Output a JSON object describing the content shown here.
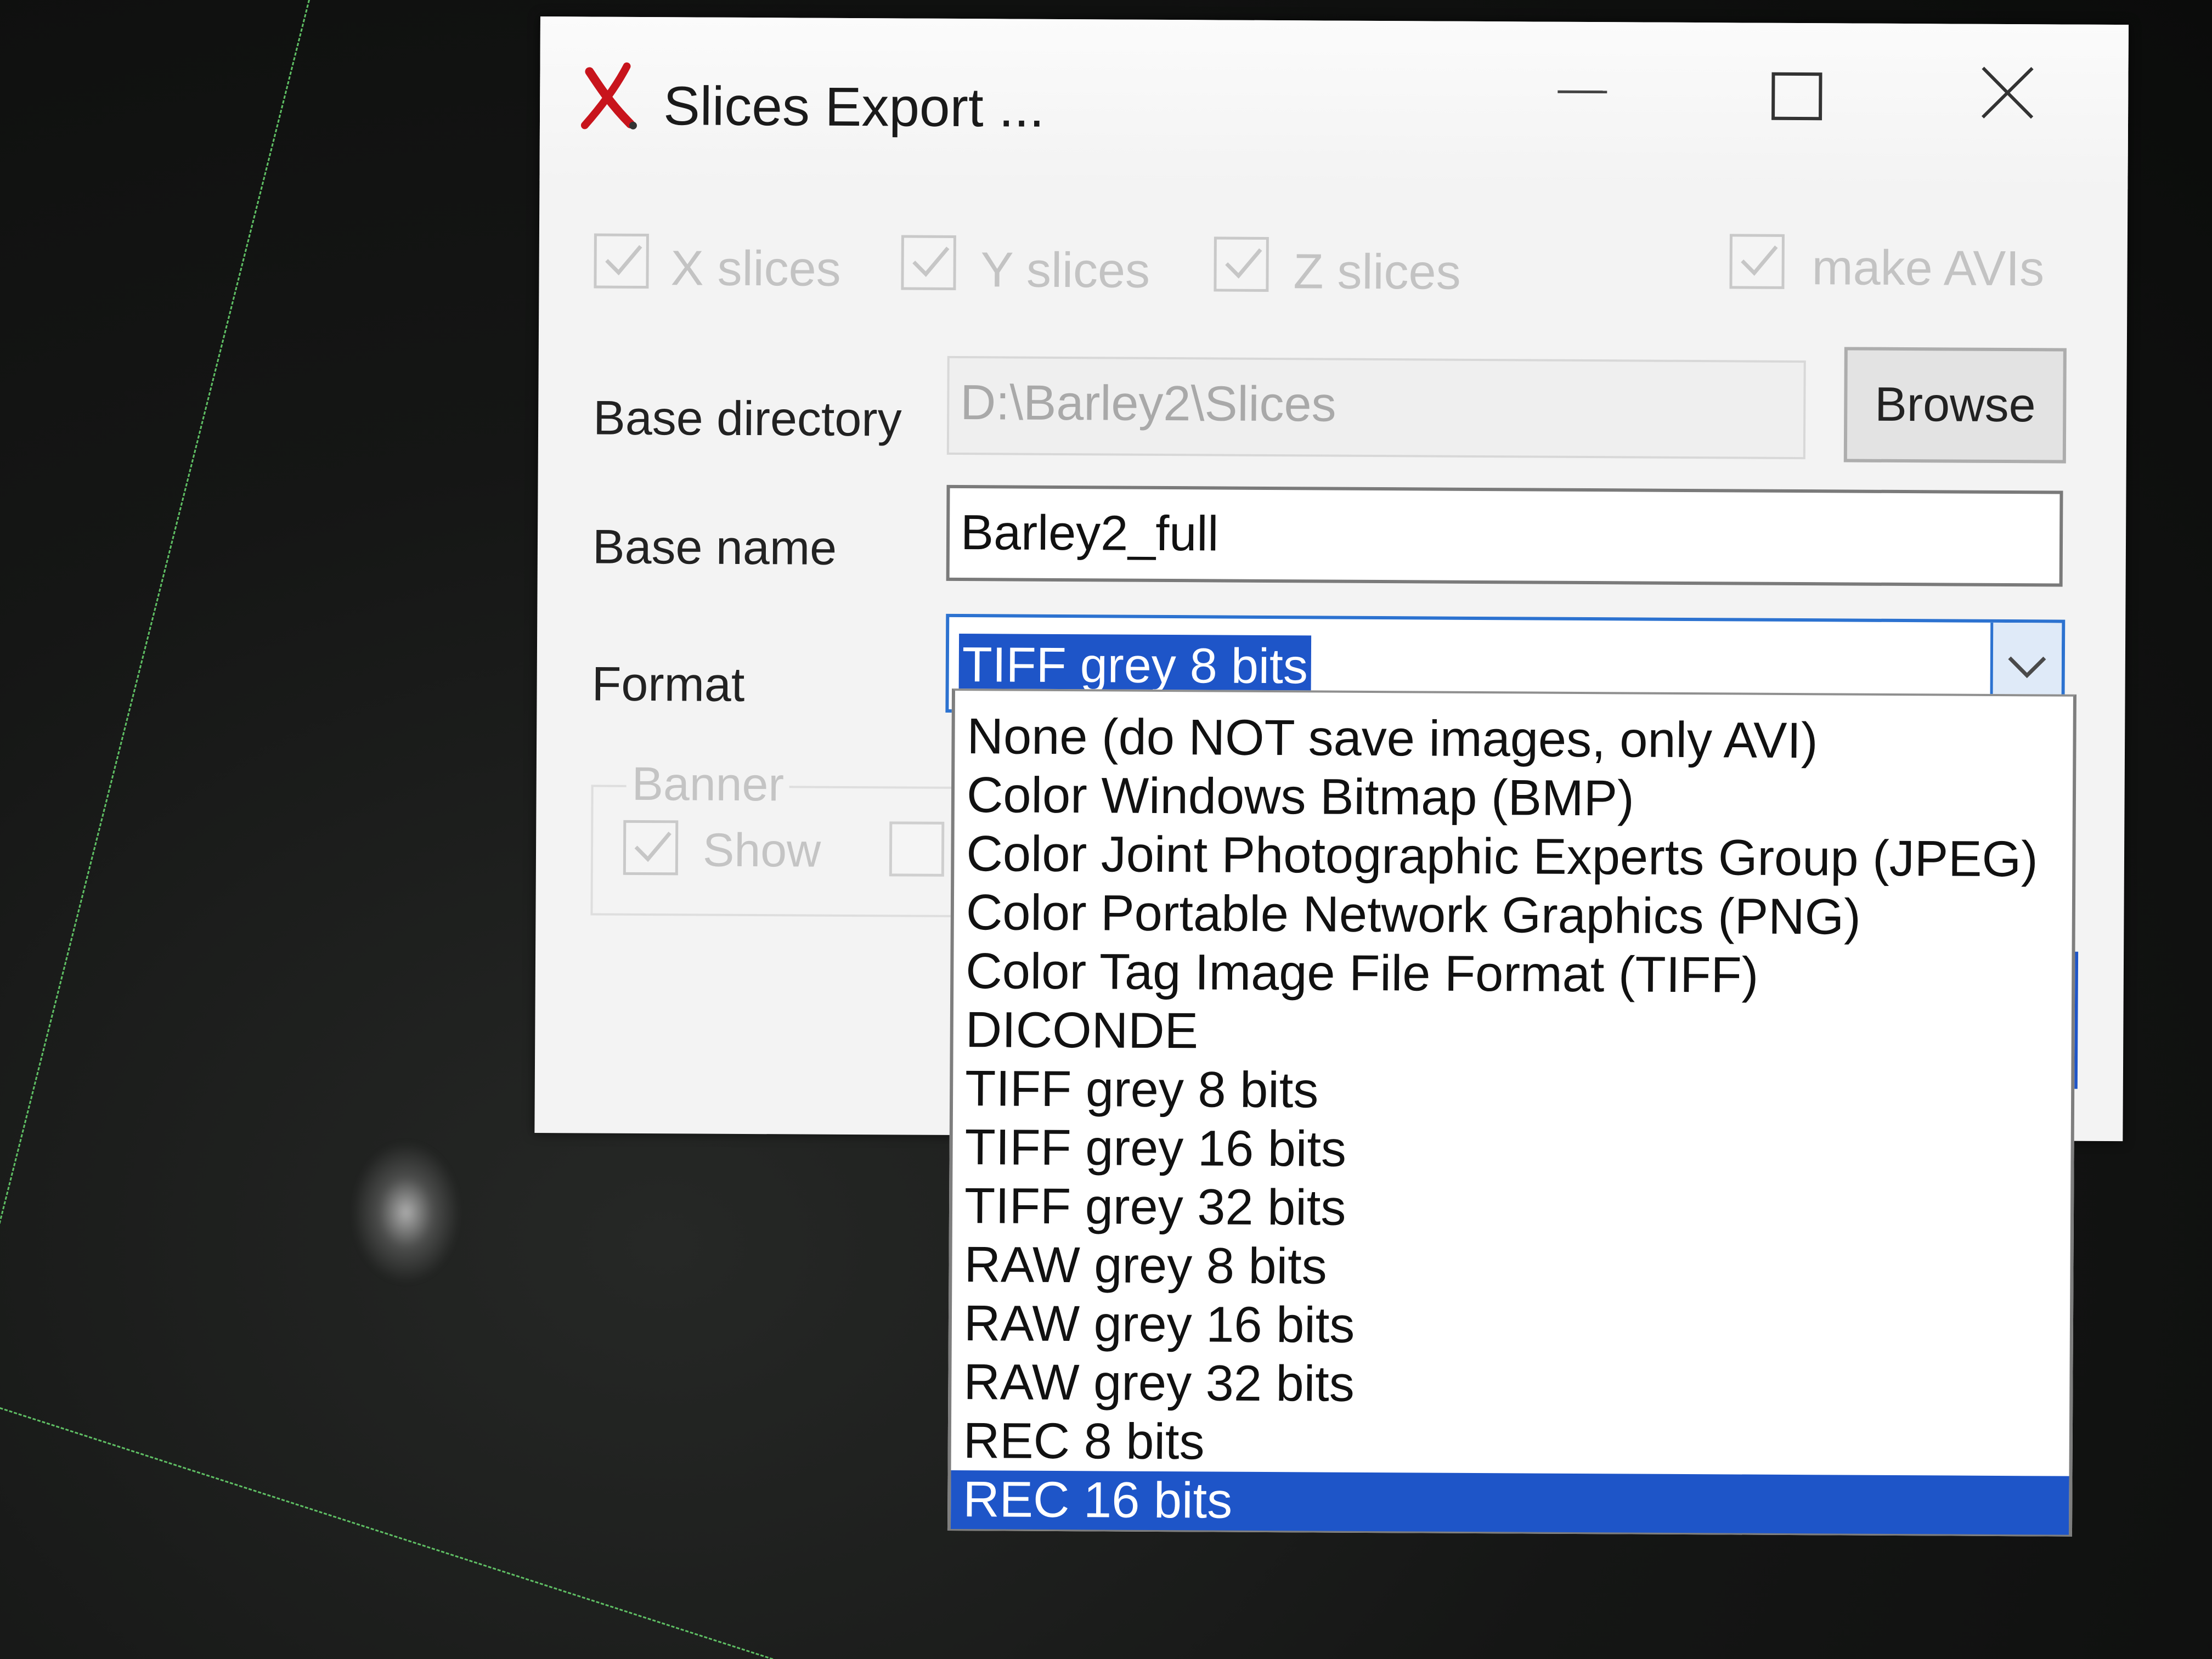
{
  "window": {
    "title": "Slices Export ...",
    "controls": [
      "minimize",
      "maximize",
      "close"
    ]
  },
  "options": {
    "x_slices": {
      "label": "X slices",
      "checked": true,
      "enabled": false
    },
    "y_slices": {
      "label": "Y slices",
      "checked": true,
      "enabled": false
    },
    "z_slices": {
      "label": "Z slices",
      "checked": true,
      "enabled": false
    },
    "make_avis": {
      "label": "make AVIs",
      "checked": true,
      "enabled": false
    }
  },
  "base_directory": {
    "label": "Base directory",
    "value": "D:\\Barley2\\Slices",
    "browse_label": "Browse"
  },
  "base_name": {
    "label": "Base name",
    "value": "Barley2_full"
  },
  "format": {
    "label": "Format",
    "selected": "TIFF grey 8 bits",
    "options": [
      "None (do NOT save images, only AVI)",
      "Color Windows Bitmap (BMP)",
      "Color Joint Photographic Experts Group (JPEG)",
      "Color Portable Network Graphics (PNG)",
      "Color Tag Image File Format (TIFF)",
      "DICONDE",
      "TIFF grey 8 bits",
      "TIFF grey 16 bits",
      "TIFF grey 32 bits",
      "RAW grey 8 bits",
      "RAW grey 16 bits",
      "RAW grey 32 bits",
      "REC 8 bits",
      "REC 16 bits"
    ],
    "highlighted": "REC 16 bits"
  },
  "banner": {
    "group_label": "Banner",
    "show_label": "Show",
    "show_checked": true,
    "enabled": false
  },
  "colors": {
    "selection": "#1e55c8",
    "focus_border": "#2c72d0",
    "guide_line": "#5fbf64"
  }
}
